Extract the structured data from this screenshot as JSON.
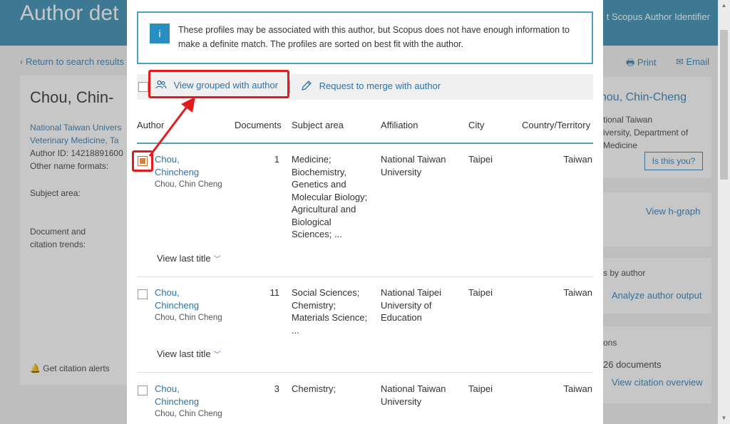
{
  "background": {
    "header_title": "Author det",
    "header_link": "t Scopus Author Identifier",
    "return_link": "Return to search results",
    "print_label": "Print",
    "email_label": "Email",
    "author_name": "Chou, Chin-",
    "affiliation_line1": "National Taiwan Univers",
    "affiliation_line2": "Veterinary Medicine, Ta",
    "author_id": "Author ID: 14218891600",
    "other_names": "Other name formats:",
    "subject_area": "Subject area:",
    "doc_trends_1": "Document and",
    "doc_trends_2": "citation trends:",
    "citation_alerts": "Get citation alerts",
    "right_name": "hou, Chin-Cheng",
    "right_aff_1": "tional Taiwan",
    "right_aff_2": "iversity, Department of",
    "right_aff_3": "Medicine",
    "is_this_you": "Is this you?",
    "view_hgraph": "View h-graph",
    "by_author": "s by author",
    "analyze_output": "Analyze author output",
    "ons": "ons",
    "documents_count": "26 documents",
    "view_citation": "View citation overview"
  },
  "modal": {
    "info_text": "These profiles may be associated with this author, but Scopus does not have enough information to make a definite match. The profiles are sorted on best fit with the author.",
    "toolbar": {
      "view_grouped": "View grouped with author",
      "request_merge": "Request to merge with author"
    },
    "columns": {
      "author": "Author",
      "documents": "Documents",
      "subject": "Subject area",
      "affiliation": "Affiliation",
      "city": "City",
      "country": "Country/Territory"
    },
    "rows": [
      {
        "name_1": "Chou,",
        "name_2": "Chincheng",
        "alt": "Chou, Chin Cheng",
        "documents": "1",
        "subject": [
          "Medicine;",
          "Biochemistry,",
          "Genetics and",
          "Molecular Biology;",
          "Agricultural and",
          "Biological",
          "Sciences; ..."
        ],
        "affiliation": [
          "National Taiwan",
          "University"
        ],
        "city": "Taipei",
        "country": "Taiwan",
        "view_last": "View last title",
        "checked": true
      },
      {
        "name_1": "Chou,",
        "name_2": "Chincheng",
        "alt": "Chou, Chin Cheng",
        "documents": "11",
        "subject": [
          "Social Sciences;",
          "Chemistry;",
          "Materials Science;",
          "..."
        ],
        "affiliation": [
          "National Taipei",
          "University of",
          "Education"
        ],
        "city": "Taipei",
        "country": "Taiwan",
        "view_last": "View last title",
        "checked": false
      },
      {
        "name_1": "Chou,",
        "name_2": "Chincheng",
        "alt": "Chou, Chin Cheng",
        "documents": "3",
        "subject": [
          "Chemistry;"
        ],
        "affiliation": [
          "National Taiwan",
          "University"
        ],
        "city": "Taipei",
        "country": "Taiwan",
        "checked": false
      }
    ]
  },
  "icons": {
    "info": "info-icon",
    "group": "people-icon",
    "merge": "pencil-icon",
    "chevron": "chevron-down-icon"
  },
  "colors": {
    "header": "#4f9cbc",
    "link": "#2a73ab",
    "highlight": "#e21c1c",
    "checkbox_checked": "#e0803a"
  }
}
